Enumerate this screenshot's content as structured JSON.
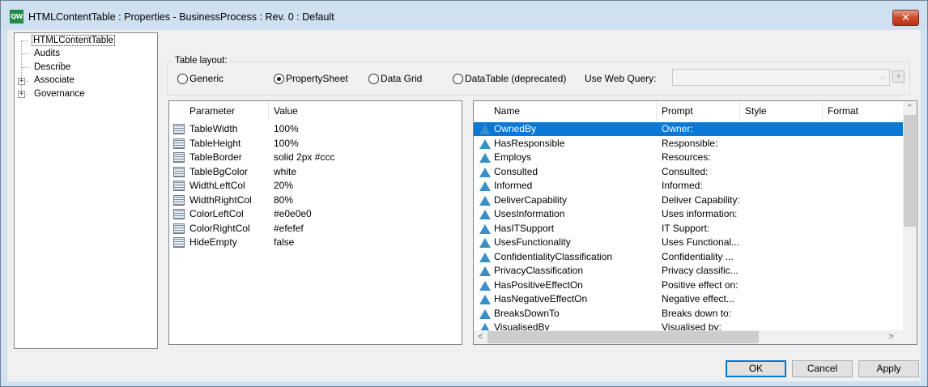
{
  "window": {
    "app_icon_text": "QW",
    "title": "HTMLContentTable : Properties - BusinessProcess : Rev. 0  : Default",
    "close_glyph": "✕"
  },
  "tree": {
    "items": [
      {
        "label": "HTMLContentTable",
        "expandable": false,
        "selected": true
      },
      {
        "label": "Audits",
        "expandable": false
      },
      {
        "label": "Describe",
        "expandable": false
      },
      {
        "label": "Associate",
        "expandable": true
      },
      {
        "label": "Governance",
        "expandable": true
      }
    ],
    "expander_glyph": "+"
  },
  "layout_group": {
    "label": "Table layout:",
    "options": [
      {
        "label": "Generic",
        "checked": false
      },
      {
        "label": "PropertySheet",
        "checked": true
      },
      {
        "label": "Data Grid",
        "checked": false
      },
      {
        "label": "DataTable (deprecated)",
        "checked": false
      }
    ],
    "web_query_label": "Use Web Query:",
    "web_query_value": "",
    "combo_arrow": "⌵",
    "add_glyph": "+"
  },
  "params_table": {
    "headers": [
      "Parameter",
      "Value"
    ],
    "rows": [
      {
        "param": "TableWidth",
        "value": "100%"
      },
      {
        "param": "TableHeight",
        "value": "100%"
      },
      {
        "param": "TableBorder",
        "value": "solid 2px #ccc"
      },
      {
        "param": "TableBgColor",
        "value": "white"
      },
      {
        "param": "WidthLeftCol",
        "value": "20%"
      },
      {
        "param": "WidthRightCol",
        "value": "80%"
      },
      {
        "param": "ColorLeftCol",
        "value": "#e0e0e0"
      },
      {
        "param": "ColorRightCol",
        "value": "#efefef"
      },
      {
        "param": "HideEmpty",
        "value": "false"
      }
    ]
  },
  "names_table": {
    "headers": [
      "Name",
      "Prompt",
      "Style",
      "Format"
    ],
    "selected_index": 0,
    "rows": [
      {
        "name": "OwnedBy",
        "prompt": "Owner:"
      },
      {
        "name": "HasResponsible",
        "prompt": "Responsible:"
      },
      {
        "name": "Employs",
        "prompt": "Resources:"
      },
      {
        "name": "Consulted",
        "prompt": "Consulted:"
      },
      {
        "name": "Informed",
        "prompt": "Informed:"
      },
      {
        "name": "DeliverCapability",
        "prompt": "Deliver Capability:"
      },
      {
        "name": "UsesInformation",
        "prompt": "Uses information:"
      },
      {
        "name": "HasITSupport",
        "prompt": "IT Support:"
      },
      {
        "name": "UsesFunctionality",
        "prompt": "Uses Functional..."
      },
      {
        "name": "ConfidentialityClassification",
        "prompt": "Confidentiality ..."
      },
      {
        "name": "PrivacyClassification",
        "prompt": "Privacy classific..."
      },
      {
        "name": "HasPositiveEffectOn",
        "prompt": "Positive effect on:"
      },
      {
        "name": "HasNegativeEffectOn",
        "prompt": "Negative effect..."
      },
      {
        "name": "BreaksDownTo",
        "prompt": "Breaks down to:"
      },
      {
        "name": "VisualisedBy",
        "prompt": "Visualised by:"
      }
    ],
    "scroll_up_glyph": "⌃",
    "scroll_left_glyph": "<",
    "scroll_right_glyph": ">"
  },
  "buttons": {
    "ok": "OK",
    "cancel": "Cancel",
    "apply": "Apply"
  },
  "colors": {
    "selection": "#0a78d7",
    "icon_blue": "#3a8fc8"
  }
}
